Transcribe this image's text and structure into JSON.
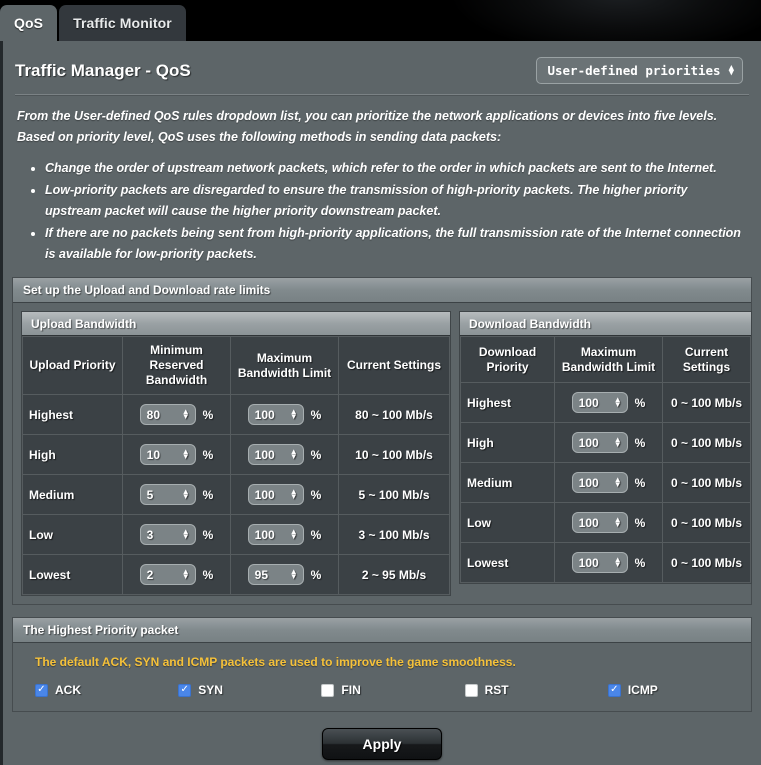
{
  "tabs": [
    {
      "label": "QoS",
      "active": true
    },
    {
      "label": "Traffic Monitor",
      "active": false
    }
  ],
  "header": {
    "title": "Traffic Manager - QoS",
    "dropdown_value": "User-defined priorities",
    "dropdown_icon": "updown-arrows-icon"
  },
  "description": {
    "intro": "From the User-defined QoS rules dropdown list, you can prioritize the network applications or devices into five levels. Based on priority level, QoS uses the following methods in sending data packets:",
    "bullets": [
      "Change the order of upstream network packets, which refer to the order in which packets are sent to the Internet.",
      "Low-priority packets are disregarded to ensure the transmission of high-priority packets. The higher priority upstream packet will cause the higher priority downstream packet.",
      "If there are no packets being sent from high-priority applications, the full transmission rate of the Internet connection is available for low-priority packets."
    ]
  },
  "rate_section": {
    "title": "Set up the Upload and Download rate limits",
    "upload": {
      "title": "Upload Bandwidth",
      "columns": [
        "Upload Priority",
        "Minimum Reserved Bandwidth",
        "Maximum Bandwidth Limit",
        "Current Settings"
      ],
      "rows": [
        {
          "priority": "Highest",
          "min": "80",
          "min_unit": "%",
          "max": "100",
          "max_unit": "%",
          "current": "80 ~ 100 Mb/s"
        },
        {
          "priority": "High",
          "min": "10",
          "min_unit": "%",
          "max": "100",
          "max_unit": "%",
          "current": "10 ~ 100 Mb/s"
        },
        {
          "priority": "Medium",
          "min": "5",
          "min_unit": "%",
          "max": "100",
          "max_unit": "%",
          "current": "5 ~ 100 Mb/s"
        },
        {
          "priority": "Low",
          "min": "3",
          "min_unit": "%",
          "max": "100",
          "max_unit": "%",
          "current": "3 ~ 100 Mb/s"
        },
        {
          "priority": "Lowest",
          "min": "2",
          "min_unit": "%",
          "max": "95",
          "max_unit": "%",
          "current": "2 ~ 95 Mb/s"
        }
      ]
    },
    "download": {
      "title": "Download Bandwidth",
      "columns": [
        "Download Priority",
        "Maximum Bandwidth Limit",
        "Current Settings"
      ],
      "rows": [
        {
          "priority": "Highest",
          "max": "100",
          "max_unit": "%",
          "current": "0 ~ 100 Mb/s"
        },
        {
          "priority": "High",
          "max": "100",
          "max_unit": "%",
          "current": "0 ~ 100 Mb/s"
        },
        {
          "priority": "Medium",
          "max": "100",
          "max_unit": "%",
          "current": "0 ~ 100 Mb/s"
        },
        {
          "priority": "Low",
          "max": "100",
          "max_unit": "%",
          "current": "0 ~ 100 Mb/s"
        },
        {
          "priority": "Lowest",
          "max": "100",
          "max_unit": "%",
          "current": "0 ~ 100 Mb/s"
        }
      ]
    }
  },
  "packet_section": {
    "title": "The Highest Priority packet",
    "note": "The default ACK, SYN and ICMP packets are used to improve the game smoothness.",
    "checkboxes": [
      {
        "label": "ACK",
        "checked": true
      },
      {
        "label": "SYN",
        "checked": true
      },
      {
        "label": "FIN",
        "checked": false
      },
      {
        "label": "RST",
        "checked": false
      },
      {
        "label": "ICMP",
        "checked": true
      }
    ]
  },
  "footer": {
    "apply_label": "Apply"
  },
  "colors": {
    "panel": "#5d6568",
    "table": "#3b4145",
    "accent_note": "#f5c13a",
    "checkbox_on": "#4a86e8",
    "topbar": "#000000"
  }
}
